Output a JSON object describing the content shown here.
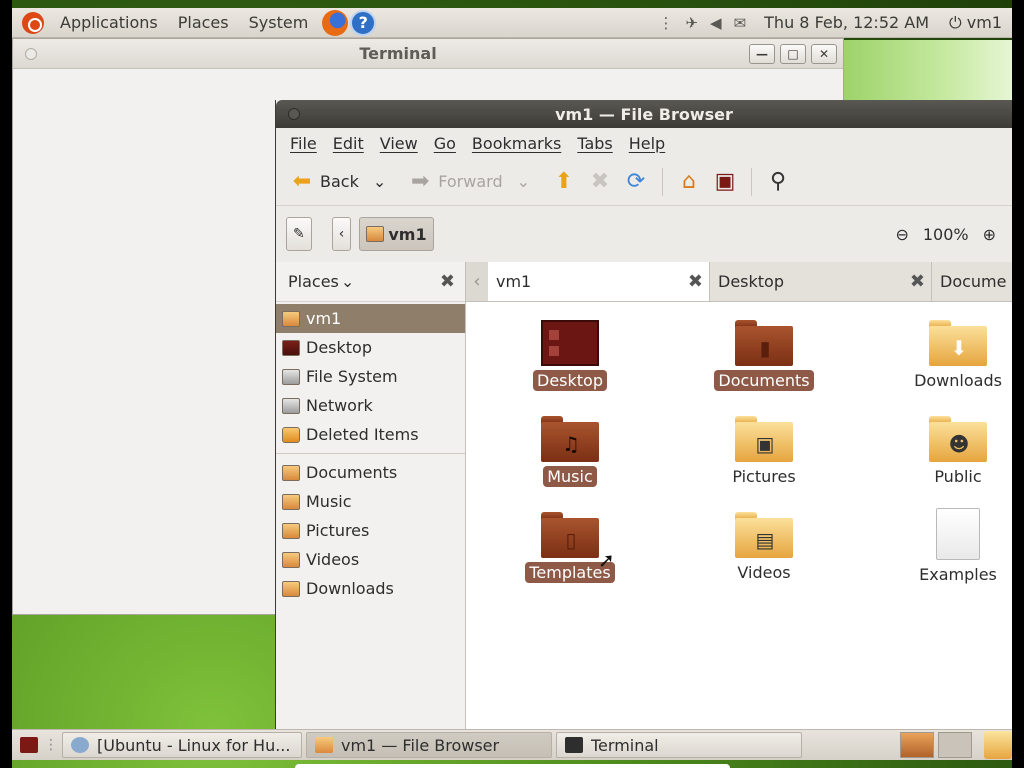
{
  "top_panel": {
    "menus": [
      "Applications",
      "Places",
      "System"
    ],
    "clock": "Thu  8 Feb, 12:52 AM",
    "user": "vm1",
    "help_glyph": "?"
  },
  "terminal": {
    "title": "Terminal",
    "buttons": {
      "minimize": "—",
      "maximize": "□",
      "close": "✕"
    }
  },
  "file_browser": {
    "title": "vm1 — File Browser",
    "menubar": [
      "File",
      "Edit",
      "View",
      "Go",
      "Bookmarks",
      "Tabs",
      "Help"
    ],
    "toolbar": {
      "back": "Back",
      "forward": "Forward"
    },
    "location": {
      "current": "vm1",
      "zoom": "100%"
    },
    "sidebar": {
      "header": "Places",
      "places": [
        "vm1",
        "Desktop",
        "File System",
        "Network",
        "Deleted Items"
      ],
      "bookmarks": [
        "Documents",
        "Music",
        "Pictures",
        "Videos",
        "Downloads"
      ]
    },
    "tabs": [
      "vm1",
      "Desktop",
      "Docume"
    ],
    "items": [
      {
        "label": "Desktop",
        "kind": "desktop",
        "selected": true
      },
      {
        "label": "Documents",
        "kind": "folder-brown",
        "selected": true
      },
      {
        "label": "Downloads",
        "kind": "folder-yellow",
        "selected": false
      },
      {
        "label": "Music",
        "kind": "folder-brown",
        "selected": true
      },
      {
        "label": "Pictures",
        "kind": "folder-yellow",
        "selected": false
      },
      {
        "label": "Public",
        "kind": "folder-yellow",
        "selected": false
      },
      {
        "label": "Templates",
        "kind": "folder-brown",
        "selected": true
      },
      {
        "label": "Videos",
        "kind": "folder-yellow",
        "selected": false
      },
      {
        "label": "Examples",
        "kind": "document",
        "selected": false
      }
    ]
  },
  "bottom_panel": {
    "tasks": [
      "[Ubuntu - Linux for Hu...",
      "vm1 — File Browser",
      "Terminal"
    ]
  }
}
